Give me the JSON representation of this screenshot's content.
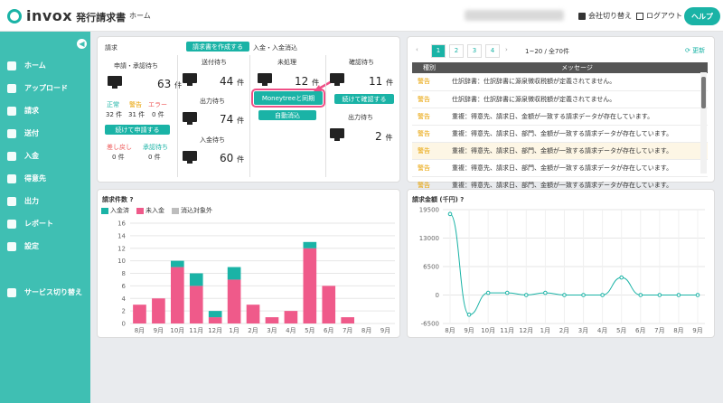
{
  "header": {
    "logo_text": "invox",
    "logo_sub": "発行請求書",
    "home": "ホーム",
    "switch_company": "会社切り替え",
    "logout": "ログアウト",
    "help": "ヘルプ"
  },
  "sidebar": {
    "items": [
      {
        "label": "ホーム",
        "icon": "home-icon"
      },
      {
        "label": "アップロード",
        "icon": "cloud-upload-icon"
      },
      {
        "label": "請求",
        "icon": "document-icon"
      },
      {
        "label": "送付",
        "icon": "send-icon"
      },
      {
        "label": "入金",
        "icon": "deposit-icon"
      },
      {
        "label": "得意先",
        "icon": "building-icon"
      },
      {
        "label": "出力",
        "icon": "export-icon"
      },
      {
        "label": "レポート",
        "icon": "report-icon"
      },
      {
        "label": "設定",
        "icon": "gear-icon"
      }
    ],
    "service_switch": "サービス切り替え"
  },
  "billing": {
    "title": "請求",
    "create_btn": "請求書を作成する",
    "approval_label": "申請・承認待ち",
    "approval_count": "63",
    "unit": "件",
    "normal_label": "正常",
    "warning_label": "警告",
    "error_label": "エラー",
    "normal_count": "32 件",
    "warning_count": "31 件",
    "error_count": "0 件",
    "apply_btn": "続けて申請する",
    "returned_label": "差し戻し",
    "approved_label": "承認待ち",
    "returned_count": "0 件",
    "approved_count": "0 件",
    "send_label": "送付待ち",
    "send_count": "44",
    "output_label": "出力待ち",
    "output_count": "74",
    "deposit_label": "入金待ち",
    "deposit_count": "60"
  },
  "reconcile": {
    "title": "入金・入金消込",
    "unprocessed_label": "未処理",
    "unprocessed_count": "12",
    "moneytree_btn": "Moneytreeと同期",
    "auto_btn": "自動消込",
    "confirm_label": "確認待ち",
    "confirm_count": "11",
    "confirm_btn": "続けて確認する",
    "output_label": "出力待ち",
    "output_count": "2"
  },
  "messages": {
    "pages": [
      "1",
      "2",
      "3",
      "4"
    ],
    "range": "1~20 / 全70件",
    "refresh": "更新",
    "col_kind": "種別",
    "col_message": "メッセージ",
    "rows": [
      {
        "kind": "警告",
        "text": "仕訳辞書：仕訳辞書に源泉徴収税額が定義されてません。"
      },
      {
        "kind": "警告",
        "text": "仕訳辞書：仕訳辞書に源泉徴収税額が定義されてません。"
      },
      {
        "kind": "警告",
        "text": "重複：得意先、請求日、金額が一致する請求データが存在しています。"
      },
      {
        "kind": "警告",
        "text": "重複：得意先、請求日、部門、金額が一致する請求データが存在しています。"
      },
      {
        "kind": "警告",
        "text": "重複：得意先、請求日、部門、金額が一致する請求データが存在しています。"
      },
      {
        "kind": "警告",
        "text": "重複：得意先、請求日、部門、金額が一致する請求データが存在しています。"
      },
      {
        "kind": "警告",
        "text": "重複：得意先、請求日、部門、金額が一致する請求データが存在しています。"
      }
    ]
  },
  "count_chart_title": "請求件数",
  "amount_chart_title": "請求金額 (千円)",
  "chart_data": [
    {
      "type": "bar",
      "title": "請求件数",
      "categories": [
        "8月",
        "9月",
        "10月",
        "11月",
        "12月",
        "1月",
        "2月",
        "3月",
        "4月",
        "5月",
        "6月",
        "7月",
        "8月",
        "9月"
      ],
      "series": [
        {
          "name": "未入金",
          "color": "#ef5a8a",
          "values": [
            3,
            4,
            9,
            6,
            1,
            7,
            3,
            1,
            2,
            12,
            6,
            1,
            0,
            0
          ]
        },
        {
          "name": "入金済",
          "color": "#1ab3a6",
          "values": [
            0,
            0,
            1,
            2,
            1,
            2,
            0,
            0,
            0,
            1,
            0,
            0,
            0,
            0
          ]
        },
        {
          "name": "消込対象外",
          "color": "#bdbdbd",
          "values": [
            0,
            0,
            0,
            0,
            0,
            0,
            0,
            0,
            0,
            0,
            0,
            0,
            0,
            0
          ]
        }
      ],
      "ylim": [
        0,
        16
      ],
      "yticks": [
        0,
        2,
        4,
        6,
        8,
        10,
        12,
        14,
        16
      ],
      "legend": "top-left"
    },
    {
      "type": "line",
      "title": "請求金額 (千円)",
      "categories": [
        "8月",
        "9月",
        "10月",
        "11月",
        "12月",
        "1月",
        "2月",
        "3月",
        "4月",
        "5月",
        "6月",
        "7月",
        "8月",
        "9月"
      ],
      "series": [
        {
          "color": "#1ab3a6",
          "values": [
            18500,
            -4500,
            500,
            500,
            0,
            500,
            0,
            0,
            0,
            4000,
            0,
            0,
            0,
            0
          ]
        }
      ],
      "ylim": [
        -6500,
        19500
      ],
      "yticks": [
        -6500,
        0,
        6500,
        13000,
        19500
      ]
    }
  ]
}
